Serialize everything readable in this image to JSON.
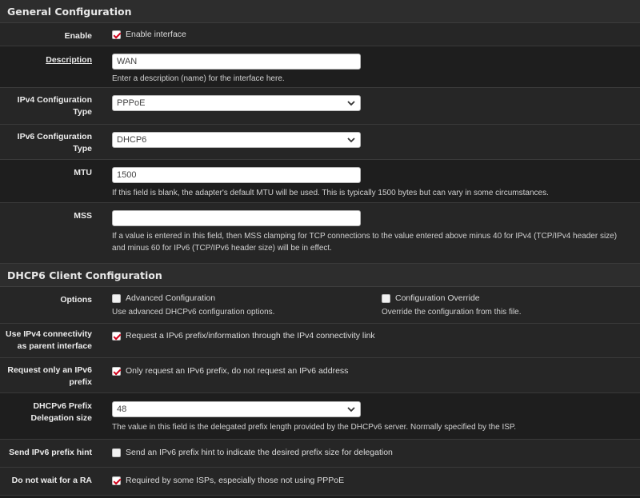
{
  "general": {
    "title": "General Configuration",
    "enable": {
      "label": "Enable",
      "checkbox_label": "Enable interface",
      "checked": true
    },
    "description": {
      "label": "Description",
      "value": "WAN",
      "help": "Enter a description (name) for the interface here."
    },
    "ipv4_type": {
      "label": "IPv4 Configuration Type",
      "value": "PPPoE"
    },
    "ipv6_type": {
      "label": "IPv6 Configuration Type",
      "value": "DHCP6"
    },
    "mtu": {
      "label": "MTU",
      "value": "1500",
      "help": "If this field is blank, the adapter's default MTU will be used. This is typically 1500 bytes but can vary in some circumstances."
    },
    "mss": {
      "label": "MSS",
      "value": "",
      "help": "If a value is entered in this field, then MSS clamping for TCP connections to the value entered above minus 40 for IPv4 (TCP/IPv4 header size) and minus 60 for IPv6 (TCP/IPv6 header size) will be in effect."
    }
  },
  "dhcp6": {
    "title": "DHCP6 Client Configuration",
    "options": {
      "label": "Options",
      "advanced": {
        "label": "Advanced Configuration",
        "help": "Use advanced DHCPv6 configuration options.",
        "checked": false
      },
      "override": {
        "label": "Configuration Override",
        "help": "Override the configuration from this file.",
        "checked": false
      }
    },
    "use_ipv4": {
      "label": "Use IPv4 connectivity as parent interface",
      "checkbox_label": "Request a IPv6 prefix/information through the IPv4 connectivity link",
      "checked": true
    },
    "request_prefix": {
      "label": "Request only an IPv6 prefix",
      "checkbox_label": "Only request an IPv6 prefix, do not request an IPv6 address",
      "checked": true
    },
    "prefix_size": {
      "label": "DHCPv6 Prefix Delegation size",
      "value": "48",
      "help": "The value in this field is the delegated prefix length provided by the DHCPv6 server. Normally specified by the ISP."
    },
    "prefix_hint": {
      "label": "Send IPv6 prefix hint",
      "checkbox_label": "Send an IPv6 prefix hint to indicate the desired prefix size for delegation",
      "checked": false
    },
    "no_wait_ra": {
      "label": "Do not wait for a RA",
      "checkbox_label": "Required by some ISPs, especially those not using PPPoE",
      "checked": true
    }
  }
}
